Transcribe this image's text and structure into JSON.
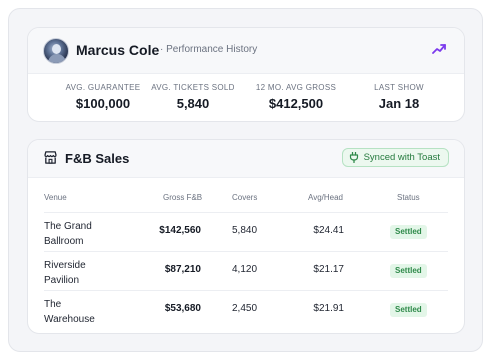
{
  "artist": {
    "name": "Marcus Cole",
    "subtitle": "· Performance History"
  },
  "stats": [
    {
      "label": "AVG. GUARANTEE",
      "value": "$100,000"
    },
    {
      "label": "AVG. TICKETS SOLD",
      "value": "5,840"
    },
    {
      "label": "12 MO. AVG GROSS",
      "value": "$412,500"
    },
    {
      "label": "LAST SHOW",
      "value": "Jan 18"
    }
  ],
  "fb": {
    "title": "F&B Sales",
    "sync_label": "Synced with Toast",
    "columns": {
      "venue": "Venue",
      "gross": "Gross F&B",
      "covers": "Covers",
      "avg": "Avg/Head",
      "status": "Status"
    },
    "rows": [
      {
        "venue": "The Grand Ballroom",
        "gross": "$142,560",
        "covers": "5,840",
        "avg": "$24.41",
        "status": "Settled"
      },
      {
        "venue": "Riverside Pavilion",
        "gross": "$87,210",
        "covers": "4,120",
        "avg": "$21.17",
        "status": "Settled"
      },
      {
        "venue": "The Warehouse",
        "gross": "$53,680",
        "covers": "2,450",
        "avg": "$21.91",
        "status": "Settled"
      }
    ]
  },
  "colors": {
    "accent_purple": "#7c3aed",
    "success_green": "#2f8a4a"
  },
  "icons": {
    "trend": "trending-up-icon",
    "store": "store-icon",
    "plug": "plug-icon"
  }
}
